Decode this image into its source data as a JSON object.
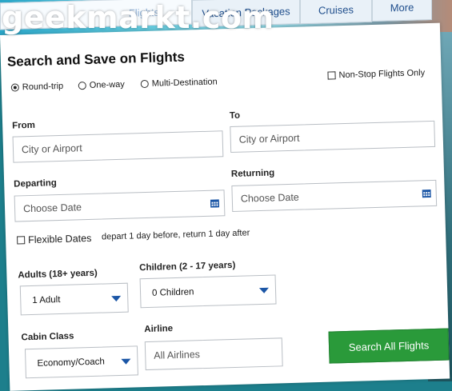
{
  "tabs": [
    {
      "label": "Flights",
      "active": true
    },
    {
      "label": "Vacation Packages",
      "active": false
    },
    {
      "label": "Cruises",
      "active": false
    },
    {
      "label": "More",
      "active": false
    }
  ],
  "watermark": "geekmarkt.com",
  "form": {
    "title": "Search and Save on Flights",
    "trip_types": [
      "Round-trip",
      "One-way",
      "Multi-Destination"
    ],
    "selected_trip": "Round-trip",
    "nonstop_label": "Non-Stop Flights Only",
    "from": {
      "label": "From",
      "placeholder": "City or Airport"
    },
    "to": {
      "label": "To",
      "placeholder": "City or Airport"
    },
    "departing": {
      "label": "Departing",
      "placeholder": "Choose Date"
    },
    "returning": {
      "label": "Returning",
      "placeholder": "Choose Date"
    },
    "flexible_label": "Flexible Dates",
    "flexible_note": "depart 1 day before, return 1 day after",
    "adults": {
      "label": "Adults (18+ years)",
      "value": "1 Adult"
    },
    "children": {
      "label": "Children (2 - 17 years)",
      "value": "0 Children"
    },
    "cabin": {
      "label": "Cabin Class",
      "value": "Economy/Coach"
    },
    "airline": {
      "label": "Airline",
      "placeholder": "All Airlines"
    },
    "search_button": "Search All Flights"
  },
  "colors": {
    "accent_blue": "#1b56a6",
    "button_green": "#2a9a3a",
    "tab_text": "#1f4e8c"
  }
}
